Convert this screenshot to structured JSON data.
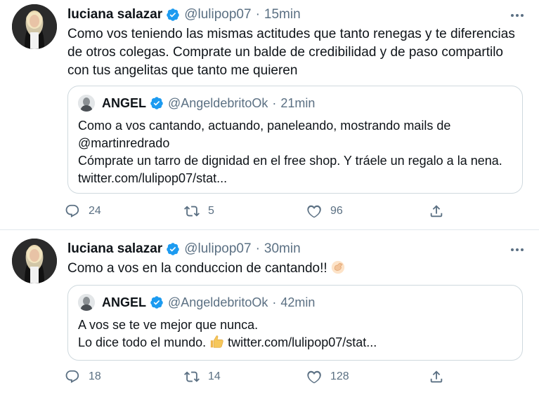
{
  "tweets": [
    {
      "author_name": "luciana salazar",
      "author_handle": "@lulipop07",
      "separator": "·",
      "time": "15min",
      "text": "Como vos teniendo las mismas actitudes que tanto renegas y te diferencias de otros colegas. Comprate un balde de credibilidad y de paso compartilo con tus angelitas que tanto me quieren",
      "quote": {
        "author_name": "ANGEL",
        "author_handle": "@AngeldebritoOk",
        "separator": "·",
        "time": "21min",
        "line1": "Como a vos cantando, actuando, paneleando, mostrando mails de",
        "line2": "@martinredrado",
        "line3": "Cómprate un tarro de dignidad en el free shop. Y tráele un regalo a la nena. twitter.com/lulipop07/stat..."
      },
      "replies": "24",
      "retweets": "5",
      "likes": "96"
    },
    {
      "author_name": "luciana salazar",
      "author_handle": "@lulipop07",
      "separator": "·",
      "time": "30min",
      "text": "Como a vos en la conduccion de cantando!!",
      "text_emoji": "clapping-hands-icon",
      "quote": {
        "author_name": "ANGEL",
        "author_handle": "@AngeldebritoOk",
        "separator": "·",
        "time": "42min",
        "line1": "A vos se te ve mejor que nunca.",
        "line2": "Lo dice todo el mundo.",
        "line2_emoji": "thumbs-up-icon",
        "line2_link": "twitter.com/lulipop07/stat..."
      },
      "replies": "18",
      "retweets": "14",
      "likes": "128"
    }
  ],
  "colors": {
    "text": "#0f1419",
    "muted": "#5b7083",
    "verified": "#1d9bf0",
    "border": "#cfd9de"
  }
}
